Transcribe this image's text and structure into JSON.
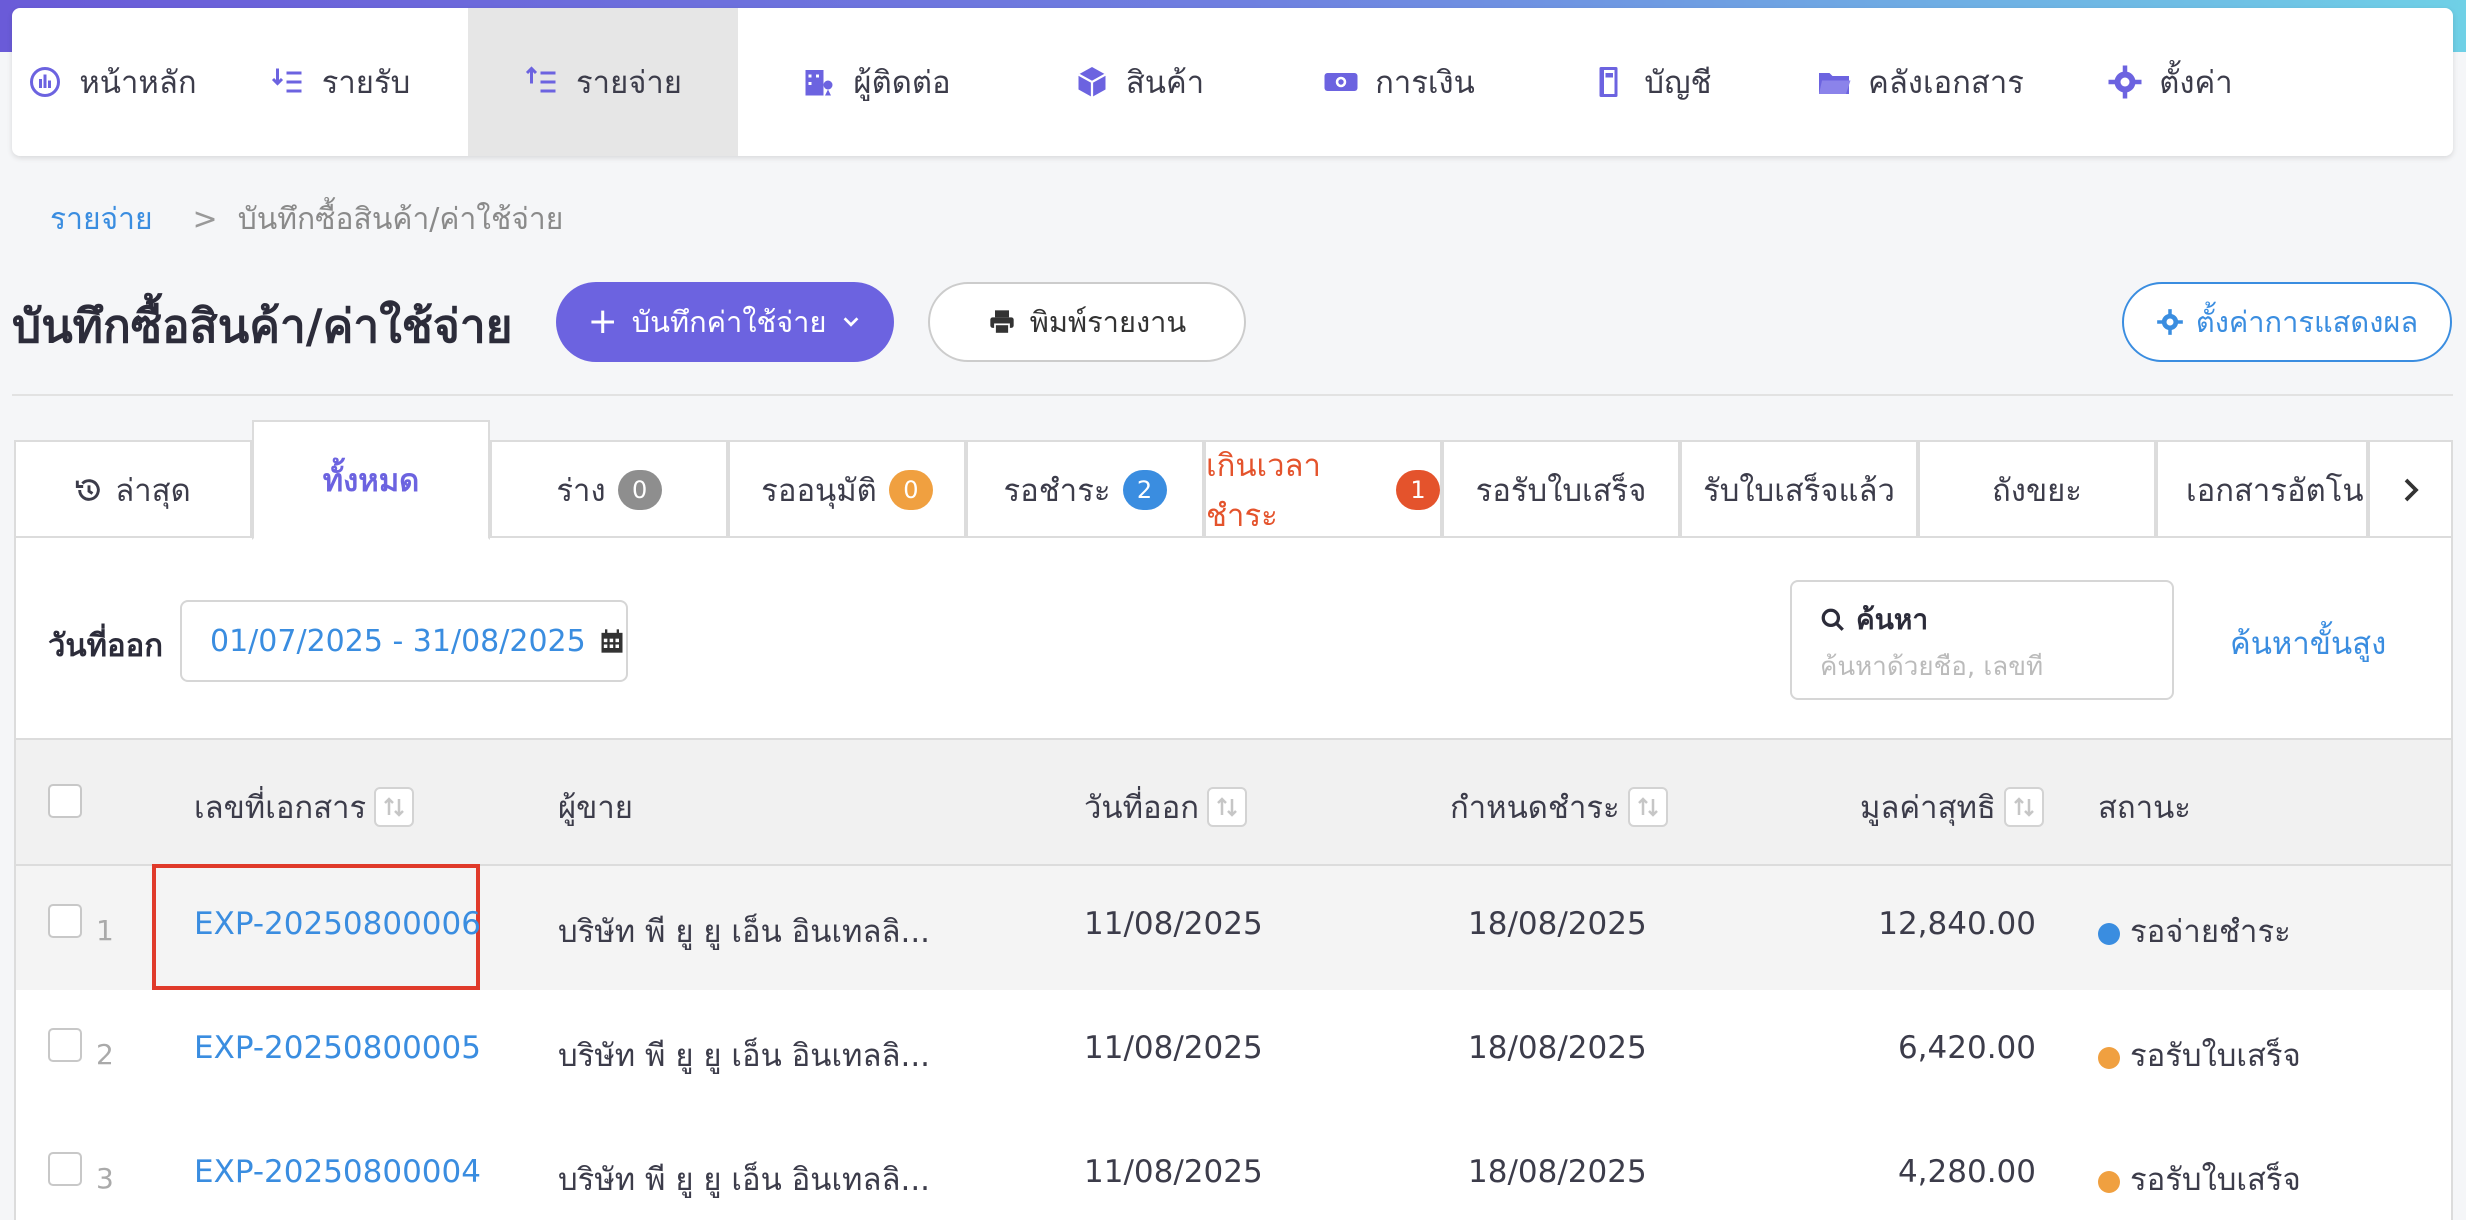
{
  "nav": {
    "items": [
      {
        "label": "หน้าหลัก",
        "icon": "dashboard-icon"
      },
      {
        "label": "รายรับ",
        "icon": "income-icon"
      },
      {
        "label": "รายจ่าย",
        "icon": "expense-icon",
        "active": true
      },
      {
        "label": "ผู้ติดต่อ",
        "icon": "contacts-icon"
      },
      {
        "label": "สินค้า",
        "icon": "box-icon"
      },
      {
        "label": "การเงิน",
        "icon": "money-icon"
      },
      {
        "label": "บัญชี",
        "icon": "ledger-icon"
      },
      {
        "label": "คลังเอกสาร",
        "icon": "folder-icon"
      },
      {
        "label": "ตั้งค่า",
        "icon": "gear-icon"
      }
    ]
  },
  "breadcrumb": {
    "parent": "รายจ่าย",
    "separator": ">",
    "current": "บันทึกซื้อสินค้า/ค่าใช้จ่าย"
  },
  "page": {
    "title": "บันทึกซื้อสินค้า/ค่าใช้จ่าย",
    "primary_button": "บันทึกค่าใช้จ่าย",
    "print_button": "พิมพ์รายงาน",
    "settings_button": "ตั้งค่าการแสดงผล"
  },
  "tabs": [
    {
      "label": "ล่าสุด",
      "icon": "history-icon"
    },
    {
      "label": "ทั้งหมด",
      "active": true
    },
    {
      "label": "ร่าง",
      "badge": "0",
      "badge_color": "#8e8e8e"
    },
    {
      "label": "รออนุมัติ",
      "badge": "0",
      "badge_color": "#f0a040"
    },
    {
      "label": "รอชำระ",
      "badge": "2",
      "badge_color": "#3a8de0"
    },
    {
      "label": "เกินเวลาชำระ",
      "badge": "1",
      "badge_color": "#e4532c",
      "danger": true
    },
    {
      "label": "รอรับใบเสร็จ"
    },
    {
      "label": "รับใบเสร็จแล้ว"
    },
    {
      "label": "ถังขยะ"
    },
    {
      "label": "เอกสารอัตโน"
    }
  ],
  "filter": {
    "date_label": "วันที่ออก",
    "date_range": "01/07/2025 - 31/08/2025",
    "search_title": "ค้นหา",
    "search_placeholder": "ค้นหาด้วยชื่อ, เลขที่",
    "advanced_search": "ค้นหาขั้นสูง"
  },
  "table": {
    "columns": {
      "doc_no": "เลขที่เอกสาร",
      "vendor": "ผู้ขาย",
      "issue_date": "วันที่ออก",
      "due_date": "กำหนดชำระ",
      "net_value": "มูลค่าสุทธิ",
      "status": "สถานะ"
    },
    "rows": [
      {
        "index": "1",
        "doc_no": "EXP-20250800006",
        "vendor": "บริษัท พี ยู ยู เอ็น อินเทลลิ...",
        "issue_date": "11/08/2025",
        "due_date": "18/08/2025",
        "net_value": "12,840.00",
        "status": "รอจ่ายชำระ",
        "status_color": "#3a8de0"
      },
      {
        "index": "2",
        "doc_no": "EXP-20250800005",
        "vendor": "บริษัท พี ยู ยู เอ็น อินเทลลิ...",
        "issue_date": "11/08/2025",
        "due_date": "18/08/2025",
        "net_value": "6,420.00",
        "status": "รอรับใบเสร็จ",
        "status_color": "#f0a040"
      },
      {
        "index": "3",
        "doc_no": "EXP-20250800004",
        "vendor": "บริษัท พี ยู ยู เอ็น อินเทลลิ...",
        "issue_date": "11/08/2025",
        "due_date": "18/08/2025",
        "net_value": "4,280.00",
        "status": "รอรับใบเสร็จ",
        "status_color": "#f0a040"
      }
    ]
  },
  "colors": {
    "accent": "#6c63e0",
    "link": "#3a8de0",
    "danger": "#e4532c",
    "highlight_border": "#e03a2a"
  }
}
